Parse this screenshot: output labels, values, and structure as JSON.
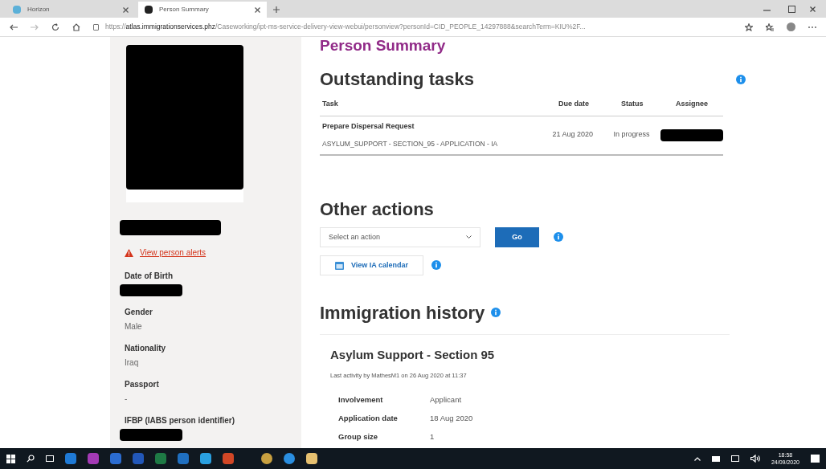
{
  "browser": {
    "tabs": [
      {
        "title": "Horizon",
        "selected": false
      },
      {
        "title": "Person Summary",
        "selected": true
      }
    ],
    "address": {
      "scheme": "https://",
      "host": "atlas.immigrationservices.phz",
      "path": "/Caseworking/ipt-ms-service-delivery-view-webui/personview?personId=CID_PEOPLE_14297888&searchTerm=KIU%2F..."
    }
  },
  "sidebar": {
    "alert_link": "View person alerts",
    "fields": [
      {
        "label": "Date of Birth",
        "kind": "redacted"
      },
      {
        "label": "Gender",
        "kind": "text",
        "value": "Male"
      },
      {
        "label": "Nationality",
        "kind": "text",
        "value": "Iraq"
      },
      {
        "label": "Passport",
        "kind": "text",
        "value": "-"
      },
      {
        "label": "IFBP (IABS person identifier)",
        "kind": "redacted"
      }
    ]
  },
  "page_title": "Person Summary",
  "outstanding_tasks": {
    "title": "Outstanding tasks",
    "columns": [
      "Task",
      "Due date",
      "Status",
      "Assignee"
    ],
    "rows": [
      {
        "task": "Prepare Dispersal Request",
        "subtitle": "ASYLUM_SUPPORT - SECTION_95 - APPLICATION - IA",
        "due_date": "21 Aug 2020",
        "status": "In progress"
      }
    ]
  },
  "other_actions": {
    "title": "Other actions",
    "select": {
      "placeholder": "Select an action"
    },
    "go_button": "Go",
    "calendar_button": "View IA calendar"
  },
  "immigration_history": {
    "title": "Immigration history",
    "card": {
      "title": "Asylum Support - Section 95",
      "last_activity": "Last activity by MathesM1 on 26 Aug 2020 at 11:37",
      "details": [
        {
          "label": "Involvement",
          "value": "Applicant"
        },
        {
          "label": "Application date",
          "value": "18 Aug 2020"
        },
        {
          "label": "Group size",
          "value": "1"
        }
      ]
    }
  },
  "taskbar": {
    "time": "18:58",
    "date": "24/09/2020"
  }
}
